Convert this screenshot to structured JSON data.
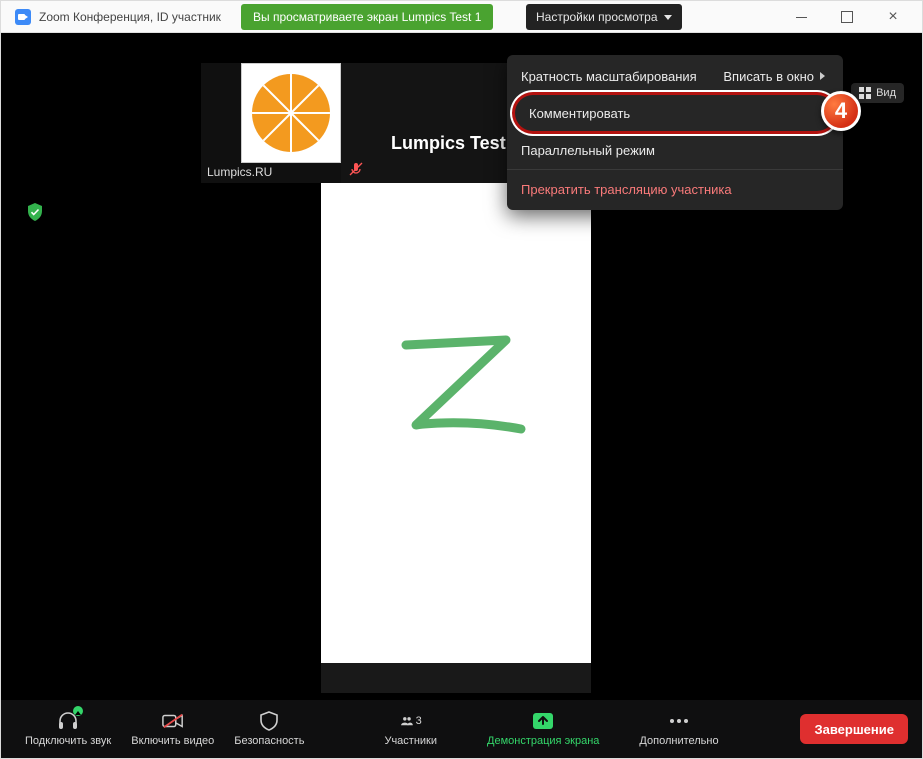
{
  "titlebar": {
    "title": "Zoom Конференция, ID участник"
  },
  "banner": {
    "text": "Вы просматриваете экран Lumpics Test 1"
  },
  "view_settings": {
    "label": "Настройки просмотра"
  },
  "dropdown": {
    "zoom_ratio": "Кратность масштабирования",
    "fit_window": "Вписать в окно",
    "annotate": "Комментировать",
    "side_by_side": "Параллельный режим",
    "stop_share": "Прекратить трансляцию участника"
  },
  "tiles": {
    "t1_label": "Lumpics.RU",
    "t2_label": "Lumpics Test"
  },
  "view_pill": {
    "label": "Вид"
  },
  "step_badge": "4",
  "toolbar": {
    "audio": "Подключить звук",
    "video": "Включить видео",
    "security": "Безопасность",
    "participants": "Участники",
    "participants_count": "3",
    "share": "Демонстрация экрана",
    "more": "Дополнительно",
    "end": "Завершение"
  }
}
